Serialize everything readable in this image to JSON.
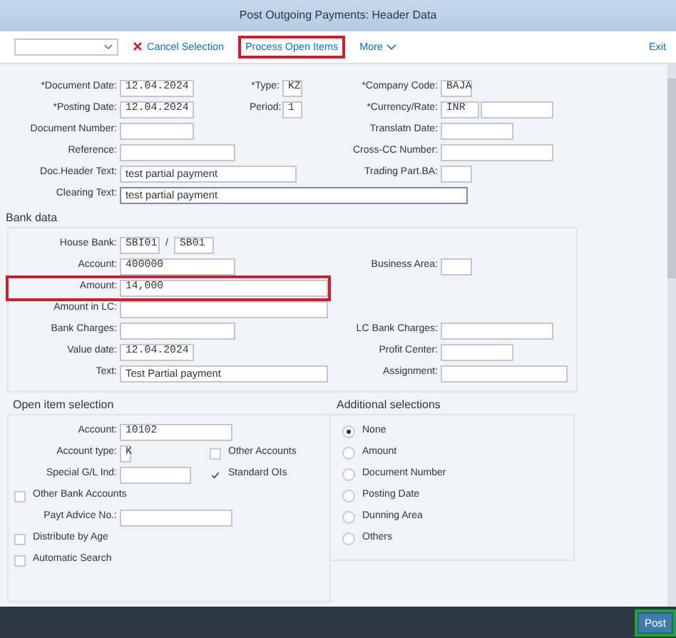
{
  "title": "Post Outgoing Payments: Header Data",
  "toolbar": {
    "buttons": [
      {
        "label": "Cancel Selection",
        "kind": "cancel",
        "highlighted": false
      },
      {
        "label": "Process Open Items",
        "kind": "plain",
        "highlighted": true
      },
      {
        "label": "More",
        "kind": "menu",
        "highlighted": false
      }
    ],
    "exit": "Exit"
  },
  "header": [
    {
      "left": {
        "label": "*Document Date:",
        "value": "12.04.2024"
      },
      "middle": {
        "label": "*Type:",
        "value": "KZ"
      },
      "right": {
        "label": "*Company Code:",
        "value": "BAJA"
      }
    },
    {
      "left": {
        "label": "*Posting Date:",
        "value": "12.04.2024"
      },
      "middle": {
        "label": "Period:",
        "value": "1"
      },
      "right": {
        "label": "*Currency/Rate:",
        "value": "INR"
      }
    },
    {
      "left": {
        "label": "Document Number:"
      },
      "right": {
        "label": "Translatn Date:"
      }
    },
    {
      "left": {
        "label": "Reference:"
      },
      "right": {
        "label": "Cross-CC Number:"
      }
    },
    {
      "left": {
        "label": "Doc.Header Text:",
        "value": "test partial payment"
      },
      "right": {
        "label": "Trading Part.BA:"
      }
    },
    {
      "left": {
        "label": "Clearing Text:",
        "value": "test partial payment",
        "focused": true
      }
    }
  ],
  "bank_data": {
    "title": "Bank data",
    "rows": [
      {
        "left": {
          "label": "House Bank:",
          "value": "SBI01",
          "separator": "/",
          "value_2": "SB01"
        }
      },
      {
        "left": {
          "label": "Account:",
          "value": "400000"
        },
        "right": {
          "label": "Business Area:"
        }
      },
      {
        "left": {
          "label": "Amount:",
          "value": "14,000",
          "highlighted": true
        }
      },
      {
        "left": {
          "label": "Amount in LC:"
        }
      },
      {
        "left": {
          "label": "Bank Charges:"
        },
        "right": {
          "label": "LC Bank Charges:"
        }
      },
      {
        "left": {
          "label": "Value date:",
          "value": "12.04.2024"
        },
        "right": {
          "label": "Profit Center:"
        }
      },
      {
        "left": {
          "label": "Text:",
          "value": "Test Partial payment"
        },
        "right": {
          "label": "Assignment:"
        }
      }
    ]
  },
  "open_item_selection": {
    "title": "Open item selection",
    "rows": [
      {
        "kind": "field",
        "label": "Account:",
        "value": "10102"
      },
      {
        "kind": "field_check",
        "label": "Account type:",
        "value": "K",
        "check_label": "Other Accounts",
        "checked": false
      },
      {
        "kind": "field_check",
        "label": "Special G/L Ind:",
        "check_label": "Standard OIs",
        "checked": true
      },
      {
        "kind": "check",
        "label": "Other Bank Accounts",
        "checked": false
      },
      {
        "kind": "field",
        "label": "Payt Advice No.:"
      },
      {
        "kind": "check",
        "label": "Distribute by Age",
        "checked": false
      },
      {
        "kind": "check",
        "label": "Automatic Search",
        "checked": false
      }
    ]
  },
  "additional_selections": {
    "title": "Additional selections",
    "options": [
      {
        "label": "None",
        "selected": true
      },
      {
        "label": "Amount",
        "selected": false
      },
      {
        "label": "Document Number",
        "selected": false
      },
      {
        "label": "Posting Date",
        "selected": false
      },
      {
        "label": "Dunning Area",
        "selected": false
      },
      {
        "label": "Others",
        "selected": false
      }
    ]
  },
  "footer": {
    "button": {
      "label": "Post",
      "highlighted": true
    }
  }
}
